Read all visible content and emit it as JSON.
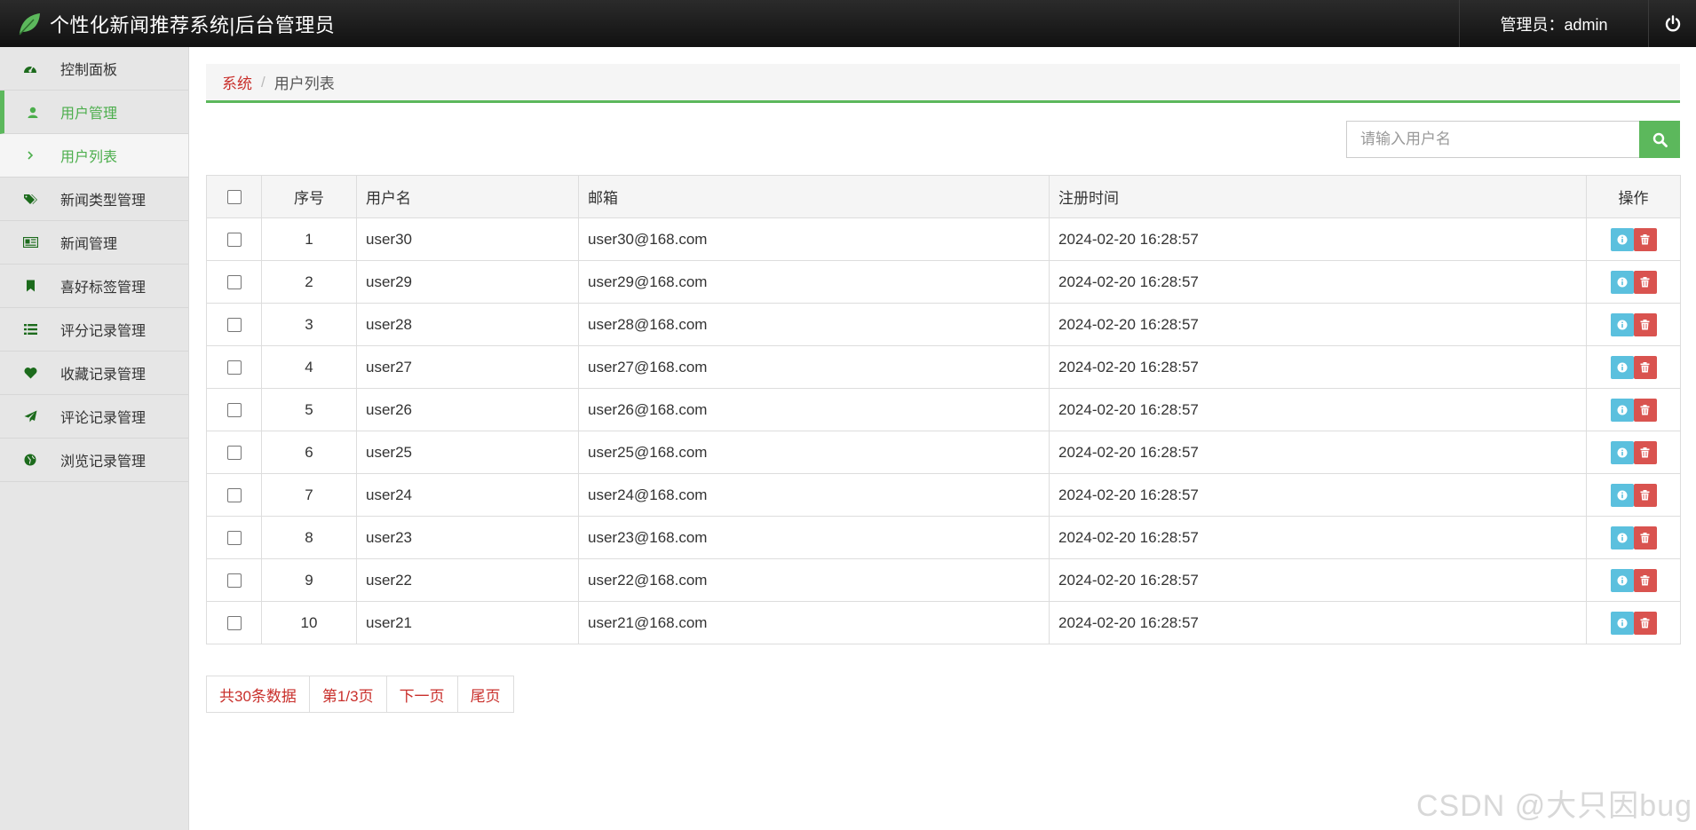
{
  "header": {
    "title": "个性化新闻推荐系统|后台管理员",
    "admin_label": "管理员：admin"
  },
  "sidebar": {
    "items": [
      {
        "label": "控制面板",
        "icon": "dashboard-icon"
      },
      {
        "label": "用户管理",
        "icon": "user-icon"
      },
      {
        "label": "用户列表",
        "icon": "chevron-right-icon"
      },
      {
        "label": "新闻类型管理",
        "icon": "tags-icon"
      },
      {
        "label": "新闻管理",
        "icon": "newspaper-icon"
      },
      {
        "label": "喜好标签管理",
        "icon": "bookmark-icon"
      },
      {
        "label": "评分记录管理",
        "icon": "list-icon"
      },
      {
        "label": "收藏记录管理",
        "icon": "heart-icon"
      },
      {
        "label": "评论记录管理",
        "icon": "send-icon"
      },
      {
        "label": "浏览记录管理",
        "icon": "globe-icon"
      }
    ]
  },
  "breadcrumb": {
    "root": "系统",
    "separator": "/",
    "current": "用户列表"
  },
  "search": {
    "placeholder": "请输入用户名"
  },
  "table": {
    "headers": [
      "序号",
      "用户名",
      "邮箱",
      "注册时间",
      "操作"
    ],
    "rows": [
      {
        "no": "1",
        "username": "user30",
        "email": "user30@168.com",
        "time": "2024-02-20 16:28:57"
      },
      {
        "no": "2",
        "username": "user29",
        "email": "user29@168.com",
        "time": "2024-02-20 16:28:57"
      },
      {
        "no": "3",
        "username": "user28",
        "email": "user28@168.com",
        "time": "2024-02-20 16:28:57"
      },
      {
        "no": "4",
        "username": "user27",
        "email": "user27@168.com",
        "time": "2024-02-20 16:28:57"
      },
      {
        "no": "5",
        "username": "user26",
        "email": "user26@168.com",
        "time": "2024-02-20 16:28:57"
      },
      {
        "no": "6",
        "username": "user25",
        "email": "user25@168.com",
        "time": "2024-02-20 16:28:57"
      },
      {
        "no": "7",
        "username": "user24",
        "email": "user24@168.com",
        "time": "2024-02-20 16:28:57"
      },
      {
        "no": "8",
        "username": "user23",
        "email": "user23@168.com",
        "time": "2024-02-20 16:28:57"
      },
      {
        "no": "9",
        "username": "user22",
        "email": "user22@168.com",
        "time": "2024-02-20 16:28:57"
      },
      {
        "no": "10",
        "username": "user21",
        "email": "user21@168.com",
        "time": "2024-02-20 16:28:57"
      }
    ]
  },
  "pager": {
    "total": "共30条数据",
    "page": "第1/3页",
    "next": "下一页",
    "last": "尾页"
  },
  "watermark": "CSDN @大只因bug",
  "colors": {
    "accent": "#5cb85c",
    "link": "#c9302c",
    "info": "#5bc0de",
    "danger": "#d9534f",
    "topbar": "#1a1a1a"
  }
}
